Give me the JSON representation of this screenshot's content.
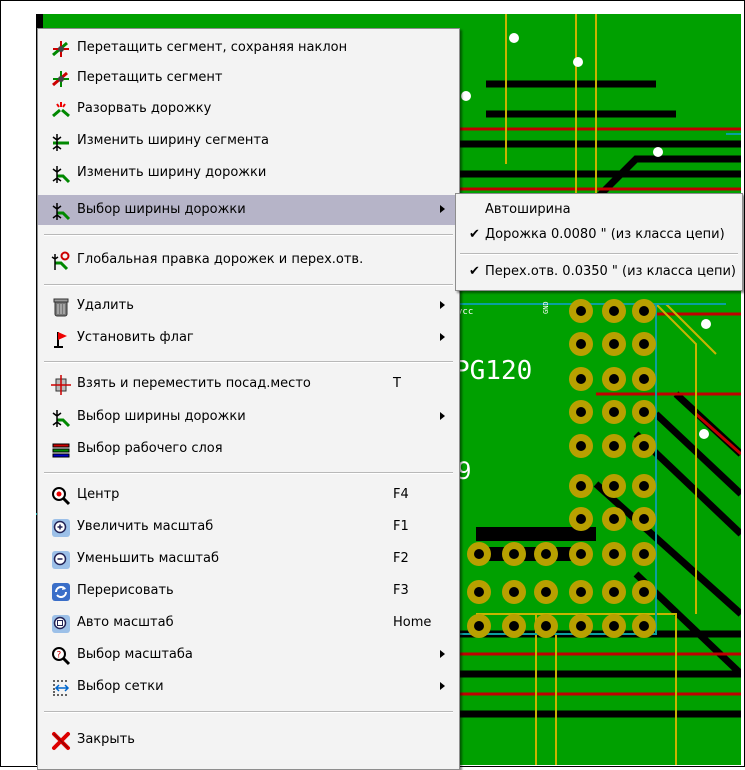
{
  "pcb": {
    "net_label": "vcc",
    "gnd_label": "GND",
    "part_ref": "PG120",
    "part_digit": "9"
  },
  "menu": {
    "items": [
      {
        "label": "Перетащить сегмент, сохраняя наклон",
        "icon": "drag-segment-keep-slope-icon"
      },
      {
        "label": "Перетащить сегмент",
        "icon": "drag-segment-icon"
      },
      {
        "label": "Разорвать дорожку",
        "icon": "break-track-icon"
      },
      {
        "label": "Изменить ширину сегмента",
        "icon": "segment-width-icon"
      },
      {
        "label": "Изменить ширину дорожки",
        "icon": "track-width-icon"
      },
      {
        "label": "Выбор ширины дорожки",
        "icon": "select-track-width-icon"
      },
      {
        "label": "Глобальная правка дорожек и перех.отв.",
        "icon": "global-edit-icon"
      },
      {
        "label": "Удалить",
        "icon": "delete-icon"
      },
      {
        "label": "Установить флаг",
        "icon": "flag-icon"
      },
      {
        "label": "Взять и переместить посад.место",
        "shortcut": "T",
        "icon": "move-footprint-icon"
      },
      {
        "label": "Выбор ширины дорожки",
        "icon": "select-track-width-icon"
      },
      {
        "label": "Выбор рабочего слоя",
        "icon": "layers-icon"
      },
      {
        "label": "Центр",
        "shortcut": "F4",
        "icon": "center-icon"
      },
      {
        "label": "Увеличить масштаб",
        "shortcut": "F1",
        "icon": "zoom-in-icon"
      },
      {
        "label": "Уменьшить масштаб",
        "shortcut": "F2",
        "icon": "zoom-out-icon"
      },
      {
        "label": "Перерисовать",
        "shortcut": "F3",
        "icon": "redraw-icon"
      },
      {
        "label": "Авто масштаб",
        "shortcut": "Home",
        "icon": "zoom-auto-icon"
      },
      {
        "label": "Выбор масштаба",
        "icon": "zoom-select-icon"
      },
      {
        "label": "Выбор сетки",
        "icon": "grid-icon"
      },
      {
        "label": "Закрыть",
        "icon": "close-icon"
      }
    ]
  },
  "submenu": {
    "items": [
      {
        "label": "Автоширина",
        "checked": false
      },
      {
        "label": "Дорожка 0.0080 \" (из класса цепи)",
        "checked": true
      },
      {
        "label": "Перех.отв. 0.0350 \" (из класса цепи)",
        "checked": true
      }
    ]
  },
  "colors": {
    "board": "#00a000",
    "track_dark": "#000000",
    "track_red": "#c00000",
    "track_yellow": "#c8b400",
    "pad": "#b8a000",
    "highlight": "#b6b4c8"
  }
}
